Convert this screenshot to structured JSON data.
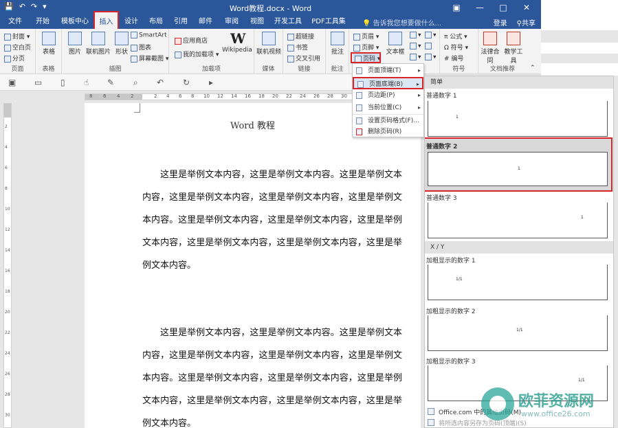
{
  "window": {
    "title": "Word教程.docx - Word",
    "controls": {
      "restore": "▣",
      "minimize": "—",
      "maximize": "□",
      "close": "✕"
    }
  },
  "qat_icons": [
    "save-icon",
    "undo-icon",
    "redo-icon",
    "customize-icon"
  ],
  "tabs": [
    {
      "label": "文件"
    },
    {
      "label": "开始"
    },
    {
      "label": "模板中心"
    },
    {
      "label": "插入"
    },
    {
      "label": "设计"
    },
    {
      "label": "布局"
    },
    {
      "label": "引用"
    },
    {
      "label": "邮件"
    },
    {
      "label": "审阅"
    },
    {
      "label": "视图"
    },
    {
      "label": "开发工具"
    },
    {
      "label": "PDF工具集"
    }
  ],
  "active_tab": "插入",
  "tell_me": "告诉我您想要做什么...",
  "account": {
    "login": "登录",
    "share": "共享"
  },
  "ribbon": {
    "pages": {
      "label": "页面",
      "cover": "封面",
      "blank": "空白页",
      "break": "分页"
    },
    "tables": {
      "label": "表格",
      "table": "表格"
    },
    "illustrations": {
      "label": "插图",
      "picture": "图片",
      "online_picture": "联机图片",
      "shapes": "形状",
      "smartart": "SmartArt",
      "chart": "图表",
      "screenshot": "屏幕截图"
    },
    "addins": {
      "label": "加载项",
      "store": "应用商店",
      "my_addins": "我的加载项",
      "wikipedia": "Wikipedia"
    },
    "media": {
      "label": "媒体",
      "online_video": "联机视频"
    },
    "links": {
      "label": "链接",
      "hyperlink": "超链接",
      "bookmark": "书签",
      "crossref": "交叉引用"
    },
    "comments": {
      "label": "批注",
      "comment": "批注"
    },
    "headerfooter": {
      "header": "页眉",
      "footer": "页脚",
      "page_number": "页码"
    },
    "text": {
      "textbox": "文本框"
    },
    "symbols": {
      "label": "符号",
      "equation": "公式",
      "symbol": "符号",
      "number": "编号"
    },
    "docrec": {
      "label": "文档推荐",
      "legal": "法律合同",
      "teaching": "教学工具"
    }
  },
  "page_number_menu": [
    {
      "label": "页面顶端(T)",
      "arrow": "▸"
    },
    {
      "label": "页面底端(B)",
      "arrow": "▸"
    },
    {
      "label": "页边距(P)",
      "arrow": "▸"
    },
    {
      "label": "当前位置(C)",
      "arrow": "▸"
    },
    {
      "label": "设置页码格式(F)..."
    },
    {
      "label": "删除页码(R)"
    }
  ],
  "gallery": {
    "cat_simple": "简单",
    "cat_xy": "X / Y",
    "items": [
      {
        "title": "普通数字 1",
        "num": "1"
      },
      {
        "title": "普通数字 2",
        "num": "1"
      },
      {
        "title": "普通数字 3",
        "num": "1"
      },
      {
        "title": "加粗显示的数字 1",
        "num": "1/1"
      },
      {
        "title": "加粗显示的数字 2",
        "num": "1/1"
      },
      {
        "title": "加粗显示的数字 3",
        "num": "1/1"
      }
    ],
    "more": "Office.com 中的其他页码(M)",
    "save_selection": "将所选内容另存为页码(顶端)(S)"
  },
  "document": {
    "header": "Word 教程",
    "paragraphs": [
      "这里是举例文本内容，这里是举例文本内容。这里是举例文本内容，这里是举例文本内容，这里是举例文本内容，这里是举例文本内容。这里是举例文本内容，这里是举例文本内容，这里是举例文本内容，这里是举例文本内容，这里是举例文本内容，这里是举例文本内容。",
      "这里是举例文本内容，这里是举例文本内容。这里是举例文本内容，这里是举例文本内容，这里是举例文本内容，这里是举例文本内容。这里是举例文本内容，这里是举例文本内容，这里是举例文本内容，这里是举例文本内容，这里是举例文本内容，这里是举例文本内容。"
    ]
  },
  "ruler": {
    "h_ticks": [
      "8",
      "6",
      "4",
      "2",
      "",
      "2",
      "4",
      "6",
      "8",
      "10",
      "12",
      "14",
      "16",
      "18",
      "20",
      "22",
      "24",
      "26",
      "28",
      "30",
      "32",
      "34",
      "36",
      "38"
    ],
    "v_ticks": [
      "2",
      "4",
      "6",
      "8",
      "10",
      "12",
      "14",
      "16",
      "18",
      "20",
      "22",
      "24",
      "26",
      "28",
      "30"
    ]
  },
  "watermark": {
    "title": "欧菲资源网",
    "subtitle": "www.office26.com"
  },
  "colors": {
    "accent": "#2b579a",
    "highlight": "#d9252a"
  }
}
